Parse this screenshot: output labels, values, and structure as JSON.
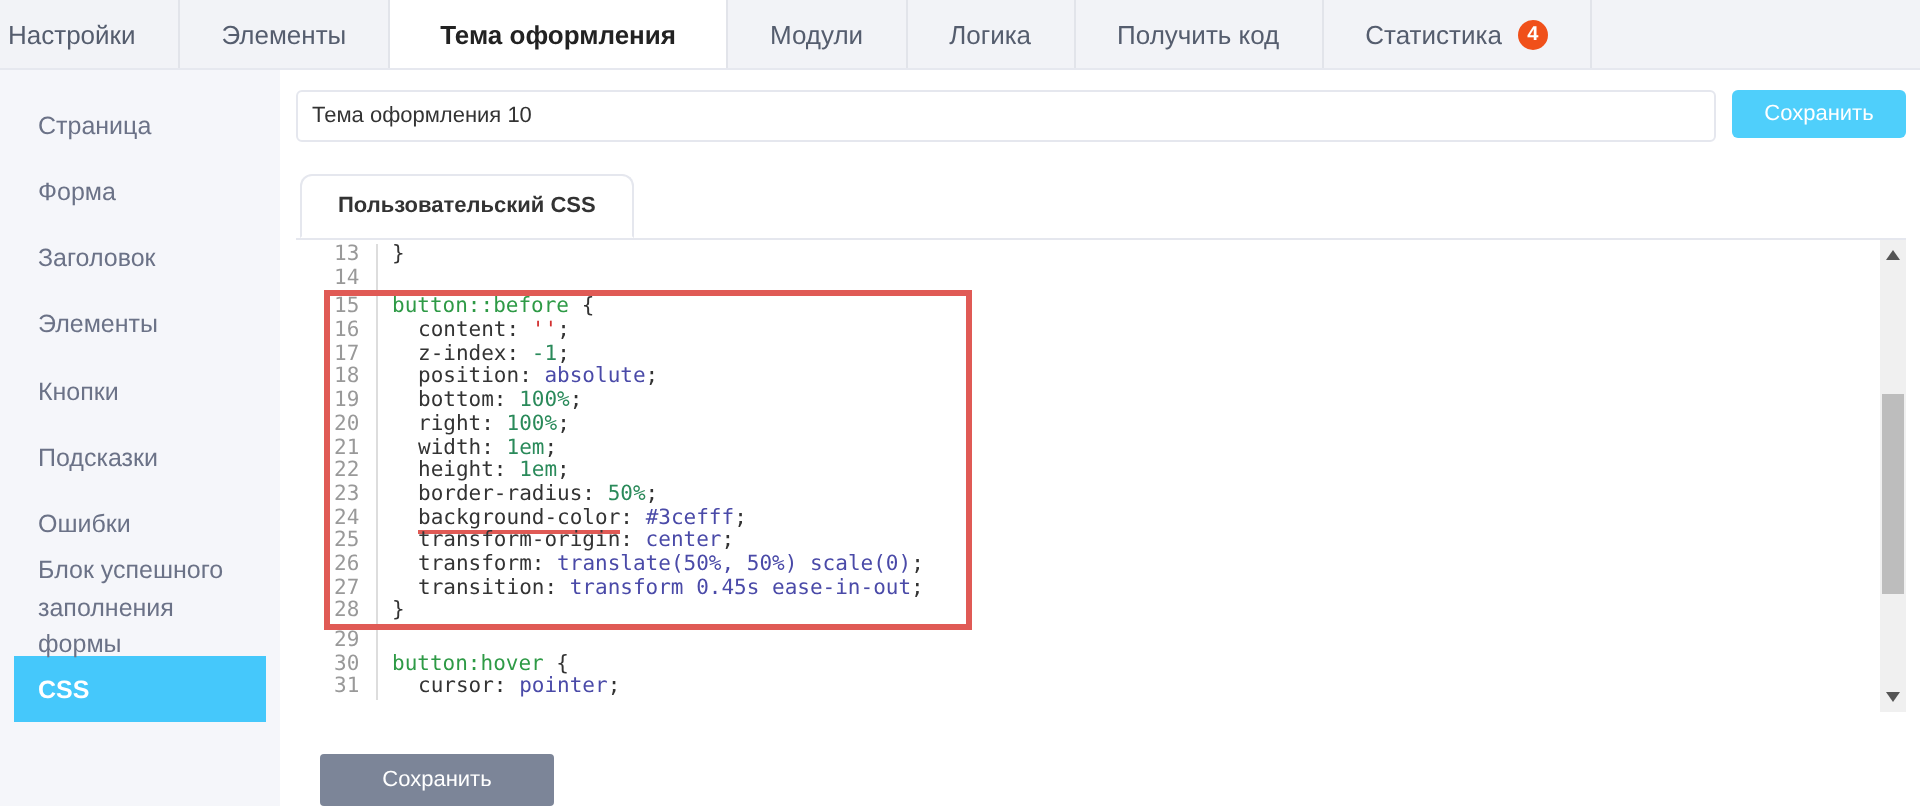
{
  "tabs": [
    {
      "label": "Настройки",
      "selected": false
    },
    {
      "label": "Элементы",
      "selected": false
    },
    {
      "label": "Тема оформления",
      "selected": true
    },
    {
      "label": "Модули",
      "selected": false
    },
    {
      "label": "Логика",
      "selected": false
    },
    {
      "label": "Получить код",
      "selected": false
    },
    {
      "label": "Статистика",
      "selected": false,
      "badge": "4"
    }
  ],
  "sidebar": {
    "items": [
      {
        "label": "Страница",
        "selected": false
      },
      {
        "label": "Форма",
        "selected": false
      },
      {
        "label": "Заголовок",
        "selected": false
      },
      {
        "label": "Элементы",
        "selected": false
      },
      {
        "label": "Кнопки",
        "selected": false
      },
      {
        "label": "Подсказки",
        "selected": false
      },
      {
        "label": "Ошибки",
        "selected": false
      },
      {
        "label": "Блок успешного заполнения формы",
        "selected": false
      },
      {
        "label": "CSS",
        "selected": true
      }
    ]
  },
  "theme_name": {
    "value": "Тема оформления 10"
  },
  "top_save_button": "Сохранить",
  "editor_tab": "Пользовательский CSS",
  "code_lines": [
    {
      "n": "13",
      "boxed": false,
      "indented": false,
      "tokens": [
        {
          "t": "}",
          "kind": "plain"
        }
      ]
    },
    {
      "n": "14",
      "boxed": false
    },
    {
      "n": "15",
      "boxed": true,
      "indented": false,
      "tokens": [
        {
          "t": "button::before",
          "kind": "selector"
        },
        {
          "t": " {",
          "kind": "plain"
        }
      ]
    },
    {
      "n": "16",
      "boxed": true,
      "indented": true,
      "tokens": [
        {
          "t": "content: ",
          "kind": "plain"
        },
        {
          "t": "''",
          "kind": "string"
        },
        {
          "t": ";",
          "kind": "plain"
        }
      ]
    },
    {
      "n": "17",
      "boxed": true,
      "indented": true,
      "tokens": [
        {
          "t": "z-index: ",
          "kind": "plain"
        },
        {
          "t": "-1",
          "kind": "number"
        },
        {
          "t": ";",
          "kind": "plain"
        }
      ]
    },
    {
      "n": "18",
      "boxed": true,
      "indented": true,
      "tokens": [
        {
          "t": "position: ",
          "kind": "plain"
        },
        {
          "t": "absolute",
          "kind": "keyword"
        },
        {
          "t": ";",
          "kind": "plain"
        }
      ]
    },
    {
      "n": "19",
      "boxed": true,
      "indented": true,
      "tokens": [
        {
          "t": "bottom: ",
          "kind": "plain"
        },
        {
          "t": "100%",
          "kind": "number"
        },
        {
          "t": ";",
          "kind": "plain"
        }
      ]
    },
    {
      "n": "20",
      "boxed": true,
      "indented": true,
      "tokens": [
        {
          "t": "right: ",
          "kind": "plain"
        },
        {
          "t": "100%",
          "kind": "number"
        },
        {
          "t": ";",
          "kind": "plain"
        }
      ]
    },
    {
      "n": "21",
      "boxed": true,
      "indented": true,
      "tokens": [
        {
          "t": "width: ",
          "kind": "plain"
        },
        {
          "t": "1em",
          "kind": "number"
        },
        {
          "t": ";",
          "kind": "plain"
        }
      ]
    },
    {
      "n": "22",
      "boxed": true,
      "indented": true,
      "tokens": [
        {
          "t": "height: ",
          "kind": "plain"
        },
        {
          "t": "1em",
          "kind": "number"
        },
        {
          "t": ";",
          "kind": "plain"
        }
      ]
    },
    {
      "n": "23",
      "boxed": true,
      "indented": true,
      "tokens": [
        {
          "t": "border-radius: ",
          "kind": "plain"
        },
        {
          "t": "50%",
          "kind": "number"
        },
        {
          "t": ";",
          "kind": "plain"
        }
      ]
    },
    {
      "n": "24",
      "boxed": true,
      "indented": true,
      "tokens": [
        {
          "t": "background-color",
          "kind": "underlined"
        },
        {
          "t": ": ",
          "kind": "plain"
        },
        {
          "t": "#3cefff",
          "kind": "keyword"
        },
        {
          "t": ";",
          "kind": "plain"
        }
      ]
    },
    {
      "n": "25",
      "boxed": true,
      "indented": true,
      "tokens": [
        {
          "t": "transform-origin: ",
          "kind": "plain"
        },
        {
          "t": "center",
          "kind": "keyword"
        },
        {
          "t": ";",
          "kind": "plain"
        }
      ]
    },
    {
      "n": "26",
      "boxed": true,
      "indented": true,
      "tokens": [
        {
          "t": "transform: ",
          "kind": "plain"
        },
        {
          "t": "translate(50%, 50%) scale(0)",
          "kind": "keyword"
        },
        {
          "t": ";",
          "kind": "plain"
        }
      ]
    },
    {
      "n": "27",
      "boxed": true,
      "indented": true,
      "tokens": [
        {
          "t": "transition: ",
          "kind": "plain"
        },
        {
          "t": "transform 0.45s ease-in-out",
          "kind": "keyword"
        },
        {
          "t": ";",
          "kind": "plain"
        }
      ]
    },
    {
      "n": "28",
      "boxed": true,
      "indented": false,
      "tokens": [
        {
          "t": "}",
          "kind": "plain"
        }
      ]
    },
    {
      "n": "29",
      "boxed": false
    },
    {
      "n": "30",
      "boxed": false,
      "indented": false,
      "tokens": [
        {
          "t": "button:hover",
          "kind": "selector"
        },
        {
          "t": " {",
          "kind": "plain"
        }
      ]
    },
    {
      "n": "31",
      "boxed": false,
      "indented": true,
      "tokens": [
        {
          "t": "cursor: ",
          "kind": "plain"
        },
        {
          "t": "pointer",
          "kind": "keyword"
        },
        {
          "t": ";",
          "kind": "plain"
        }
      ]
    }
  ],
  "bottom_save_button": "Сохранить"
}
